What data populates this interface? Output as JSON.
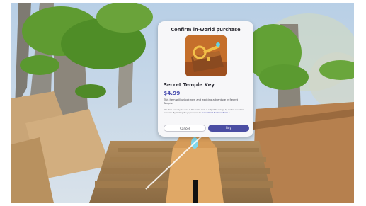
{
  "dialog": {
    "title": "Confirm in-world purchase",
    "item_name": "Secret Temple Key",
    "price": "$4.99",
    "description": "This item will unlock new and exciting adventure in Secret Temple.",
    "legal_text": "This item can only be used in this world. Item is subject to change by creator over time purchase. By clicking \"Buy\" you agree to",
    "legal_link": "Our in-World Purchase Terms",
    "legal_suffix": ">",
    "cancel_label": "Cancel",
    "buy_label": "Buy"
  },
  "colors": {
    "accent": "#4b4ea3",
    "price": "#4a4fb0",
    "dialog_bg": "#f7f7f9",
    "sky": "#c8d9ea"
  },
  "icons": {
    "item_image": "golden-key-on-chest"
  }
}
